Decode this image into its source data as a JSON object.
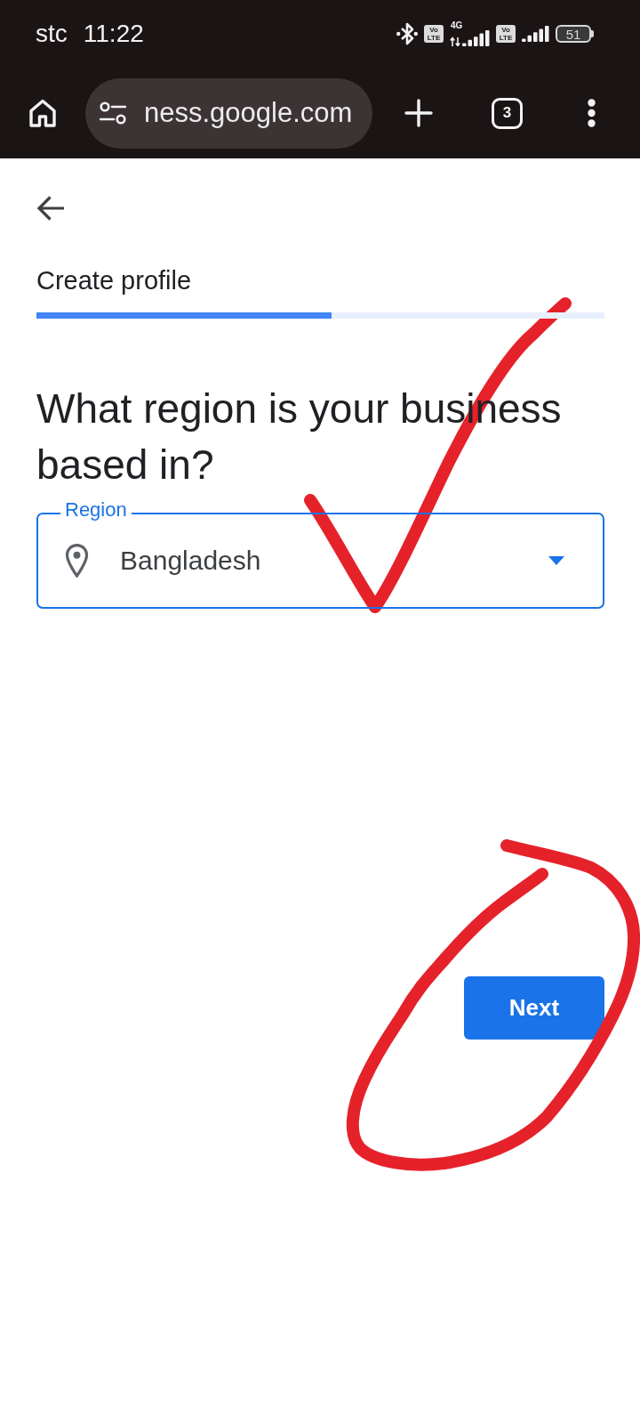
{
  "status_bar": {
    "carrier": "stc",
    "time": "11:22",
    "sims": [
      {
        "badge": "Vo LTE",
        "network": "4G"
      },
      {
        "badge": "Vo LTE"
      }
    ],
    "battery": "51"
  },
  "browser_toolbar": {
    "url": "ness.google.com",
    "tab_count": "3"
  },
  "header": {
    "title": "Create profile",
    "progress": {
      "level": 0.52
    }
  },
  "question": "What region is your business based in?",
  "region_field": {
    "label": "Region",
    "value": "Bangladesh",
    "focused": true
  },
  "buttons": [
    {
      "label": "Next"
    }
  ]
}
